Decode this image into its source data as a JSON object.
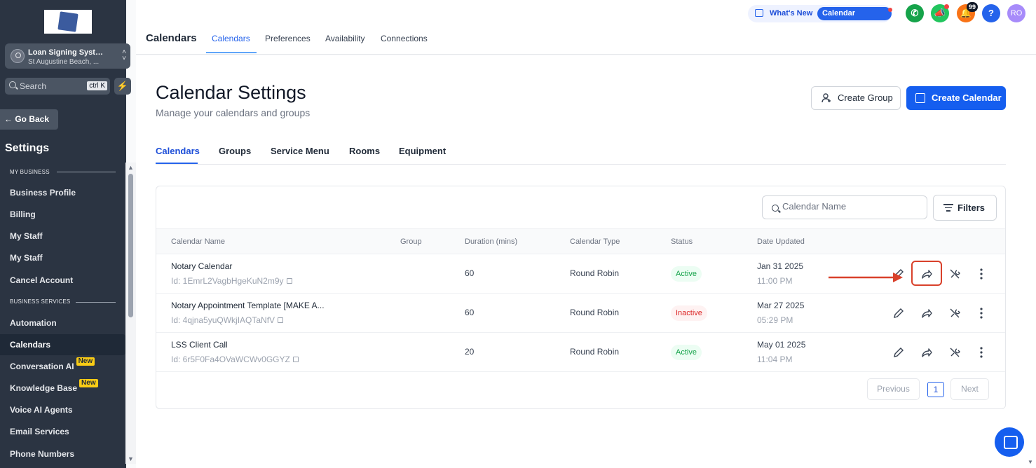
{
  "sidebar": {
    "location_name": "Loan Signing Syste...",
    "location_address": "St Augustine Beach, ...",
    "search_placeholder": "Search",
    "search_shortcut": "ctrl K",
    "go_back": "← Go Back",
    "title": "Settings",
    "section_my_business": "MY BUSINESS",
    "section_business_services": "BUSINESS SERVICES",
    "items": [
      {
        "label": "Business Profile"
      },
      {
        "label": "Billing"
      },
      {
        "label": "My Staff"
      },
      {
        "label": "My Staff"
      },
      {
        "label": "Cancel Account"
      },
      {
        "label": "Automation"
      },
      {
        "label": "Calendars"
      },
      {
        "label": "Conversation AI",
        "badge": "New"
      },
      {
        "label": "Knowledge Base",
        "badge": "New"
      },
      {
        "label": "Voice AI Agents"
      },
      {
        "label": "Email Services"
      },
      {
        "label": "Phone Numbers"
      }
    ]
  },
  "header": {
    "app_title": "Calendars",
    "tabs": [
      {
        "label": "Calendars"
      },
      {
        "label": "Preferences"
      },
      {
        "label": "Availability"
      },
      {
        "label": "Connections"
      }
    ],
    "whats_new": "What's New",
    "calendar_updates": "Calendar Updates",
    "notification_count": "99",
    "help": "?",
    "avatar_initials": "RO",
    "colors": {
      "phone": "#16a34a",
      "megaphone": "#22c55e",
      "bell": "#f97316",
      "help": "#2563eb",
      "avatar": "#a78bfa"
    }
  },
  "page": {
    "title": "Calendar Settings",
    "subtitle": "Manage your calendars and groups",
    "create_group": "Create Group",
    "create_calendar": "Create Calendar",
    "subtabs": [
      {
        "label": "Calendars"
      },
      {
        "label": "Groups"
      },
      {
        "label": "Service Menu"
      },
      {
        "label": "Rooms"
      },
      {
        "label": "Equipment"
      }
    ]
  },
  "table": {
    "search_placeholder": "Calendar Name",
    "filters": "Filters",
    "columns": [
      "Calendar Name",
      "Group",
      "Duration (mins)",
      "Calendar Type",
      "Status",
      "Date Updated"
    ],
    "rows": [
      {
        "name": "Notary Calendar",
        "id": "Id: 1EmrL2VagbHgeKuN2m9y",
        "group": "",
        "duration": "60",
        "type": "Round Robin",
        "status": "Active",
        "date": "Jan 31 2025",
        "time": "11:00 PM"
      },
      {
        "name": "Notary Appointment Template [MAKE A...",
        "id": "Id: 4qjna5yuQWkjIAQTaNfV",
        "group": "",
        "duration": "60",
        "type": "Round Robin",
        "status": "Inactive",
        "date": "Mar 27 2025",
        "time": "05:29 PM"
      },
      {
        "name": "LSS Client Call",
        "id": "Id: 6r5F0Fa4OVaWCWv0GGYZ",
        "group": "",
        "duration": "20",
        "type": "Round Robin",
        "status": "Active",
        "date": "May 01 2025",
        "time": "11:04 PM"
      }
    ],
    "pagination": {
      "previous": "Previous",
      "page": "1",
      "next": "Next"
    }
  }
}
